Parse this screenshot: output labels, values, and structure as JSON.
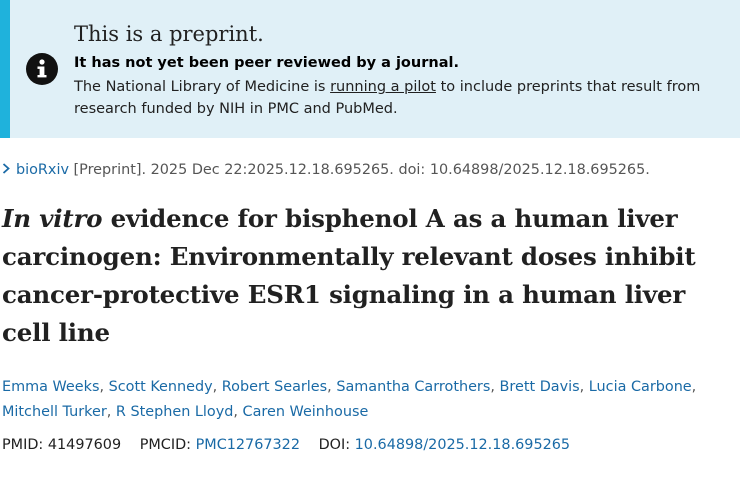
{
  "banner": {
    "title": "This is a preprint.",
    "subtitle": "It has not yet been peer reviewed by a journal.",
    "body_before": "The National Library of Medicine is ",
    "body_link": "running a pilot",
    "body_after": " to include preprints that result from research funded by NIH in PMC and PubMed.",
    "icon": "info-icon",
    "background_color": "#e0f0f7",
    "accent_color": "#1fb2dc"
  },
  "citation": {
    "journal": "bioRxiv",
    "type": "[Preprint].",
    "date_and_id": "2025 Dec 22:2025.12.18.695265.",
    "doi_text": "doi: 10.64898/2025.12.18.695265."
  },
  "article": {
    "title_italic": "In vitro",
    "title_rest": " evidence for bisphenol A as a human liver carcinogen: Environmentally relevant doses inhibit cancer-protective ESR1 signaling in a human liver cell line"
  },
  "authors": [
    "Emma Weeks",
    "Scott Kennedy",
    "Robert Searles",
    "Samantha Carrothers",
    "Brett Davis",
    "Lucia Carbone",
    "Mitchell Turker",
    "R Stephen Lloyd",
    "Caren Weinhouse"
  ],
  "ids": {
    "pmid_label": "PMID:",
    "pmid_value": "41497609",
    "pmcid_label": "PMCID:",
    "pmcid_value": "PMC12767322",
    "doi_label": "DOI:",
    "doi_value": "10.64898/2025.12.18.695265"
  },
  "colors": {
    "link": "#1a6aa6",
    "text": "#212121",
    "muted": "#555555"
  }
}
